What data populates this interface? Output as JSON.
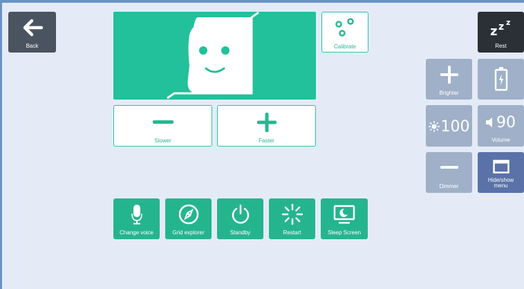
{
  "nav": {
    "back_label": "Back"
  },
  "face_panel": {
    "bg_color": "#22c09b"
  },
  "speed": {
    "slower_label": "Slower",
    "faster_label": "Faster"
  },
  "calibrate": {
    "label": "Calibrate"
  },
  "rest": {
    "label": "Rest"
  },
  "brightness": {
    "brighter_label": "Brighter",
    "dimmer_label": "Dimmer",
    "value": "100"
  },
  "battery": {
    "icon": "battery-charging-icon"
  },
  "volume": {
    "label": "Volume",
    "value": "90"
  },
  "menu": {
    "label": "Hide/show menu"
  },
  "actions": [
    {
      "label": "Change voice",
      "icon": "microphone-icon"
    },
    {
      "label": "Grid explorer",
      "icon": "compass-icon"
    },
    {
      "label": "Standby",
      "icon": "power-icon"
    },
    {
      "label": "Restart",
      "icon": "restart-icon"
    },
    {
      "label": "Sleep Screen",
      "icon": "sleep-screen-icon"
    }
  ],
  "colors": {
    "teal": "#24b58f",
    "gray": "#9fb0c8",
    "dark": "#2b2f36",
    "navy": "#5a72a8",
    "background": "#e4ebf7"
  }
}
